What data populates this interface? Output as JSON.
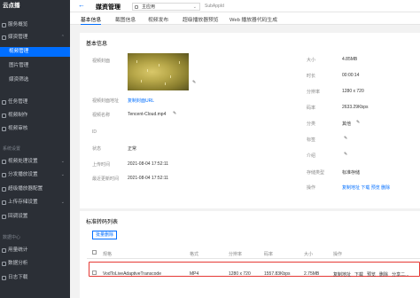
{
  "sidebar": {
    "logo": "云点播",
    "items": [
      {
        "label": "服务概览",
        "icon": "home-icon"
      },
      {
        "label": "媒资管理",
        "icon": "media-icon"
      },
      {
        "label": "视频管理"
      },
      {
        "label": "图片管理"
      },
      {
        "label": "媒资筛选"
      },
      {
        "label": "任务管理",
        "icon": "task-icon"
      },
      {
        "label": "视频制作",
        "icon": "clip-icon"
      },
      {
        "label": "视频审核",
        "icon": "audit-icon"
      },
      {
        "label": "视频处理设置",
        "icon": "process-icon"
      },
      {
        "label": "分发播放设置",
        "icon": "distribute-icon"
      },
      {
        "label": "超级播放器配置",
        "icon": "player-icon"
      },
      {
        "label": "上传存储设置",
        "icon": "upload-icon"
      },
      {
        "label": "回调设置",
        "icon": "callback-icon"
      },
      {
        "label": "用量统计",
        "icon": "usage-icon"
      },
      {
        "label": "数据分析",
        "icon": "analytics-icon"
      },
      {
        "label": "日志下载",
        "icon": "log-icon"
      }
    ],
    "groups": [
      "系统设置",
      "数据中心"
    ]
  },
  "topbar": {
    "title": "媒资管理",
    "app_select": "主应用",
    "subappid": "SubAppId"
  },
  "tabs": [
    "基本信息",
    "截图信息",
    "视频发布",
    "超级播放器预览",
    "Web 播放器代码生成"
  ],
  "basic": {
    "title": "基本信息",
    "cover_label": "视频封面",
    "cover_url_label": "视频封面地址",
    "cover_url_value": "复制封面URL",
    "name_label": "视频名称",
    "name_value": "Tencent-Cloud.mp4",
    "id_label": "ID",
    "status_label": "状态",
    "status_value": "正常",
    "upload_label": "上传时间",
    "upload_value": "2021-08-04 17:52:11",
    "update_label": "最近更新时间",
    "update_value": "2021-08-04 17:52:11",
    "right": [
      {
        "label": "大小",
        "value": "4.85MB"
      },
      {
        "label": "时长",
        "value": "00:00:14"
      },
      {
        "label": "分辨率",
        "value": "1280 x 720"
      },
      {
        "label": "码率",
        "value": "2633.29Kbps"
      },
      {
        "label": "分类",
        "value": "其他"
      },
      {
        "label": "标签",
        "value": ""
      },
      {
        "label": "介绍",
        "value": ""
      },
      {
        "label": "存储类型",
        "value": "标准存储"
      },
      {
        "label": "操作",
        "value": "复制地址 下载 预览 删除"
      }
    ]
  },
  "transcode": {
    "title": "标准转码列表",
    "batch_delete": "批量删除",
    "headers": [
      "规格",
      "格式",
      "分辨率",
      "码率",
      "大小",
      "操作"
    ],
    "row": {
      "spec": "VodToLiveAdaptiveTranscode",
      "format": "MP4",
      "resolution": "1280 x 720",
      "bitrate": "1557.83Kbps",
      "size": "2.75MB",
      "actions": [
        "复制地址",
        "下载",
        "预览",
        "删除",
        "分享二..."
      ]
    }
  }
}
